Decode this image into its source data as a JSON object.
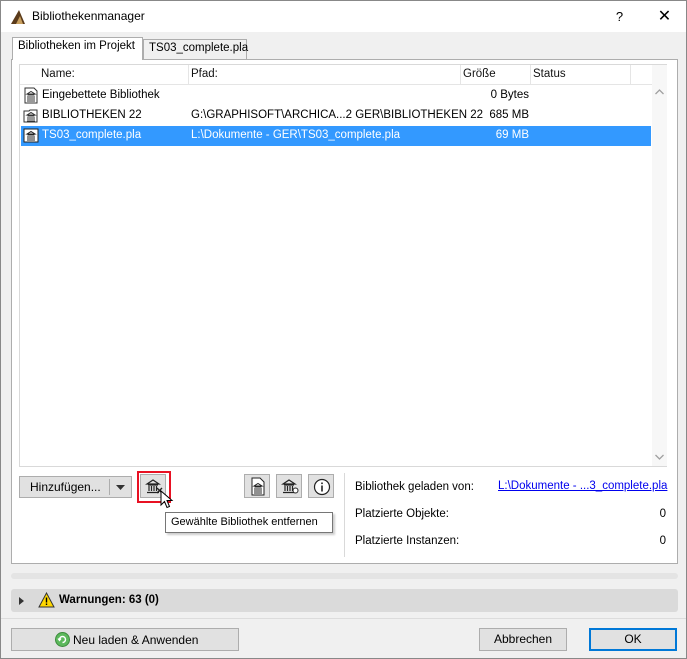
{
  "window": {
    "title": "Bibliothekenmanager",
    "help": "?",
    "close": "✕"
  },
  "tabs": [
    {
      "label": "Bibliotheken im Projekt"
    },
    {
      "label": "TS03_complete.pla"
    }
  ],
  "table": {
    "columns": [
      "Name:",
      "Pfad:",
      "Größe",
      "Status"
    ],
    "rows": [
      {
        "name": "Eingebettete Bibliothek",
        "path": "",
        "size": "0 Bytes",
        "status": ""
      },
      {
        "name": "BIBLIOTHEKEN 22",
        "path": "G:\\GRAPHISOFT\\ARCHICA...2 GER\\BIBLIOTHEKEN 22",
        "size": "685 MB",
        "status": ""
      },
      {
        "name": "TS03_complete.pla",
        "path": "L:\\Dokumente - GER\\TS03_complete.pla",
        "size": "69 MB",
        "status": ""
      }
    ]
  },
  "toolbar": {
    "add_label": "Hinzufügen...",
    "tooltip": "Gewählte Bibliothek entfernen"
  },
  "info": {
    "loaded_from_label": "Bibliothek geladen von:",
    "loaded_from_value": "L:\\Dokumente - ...3_complete.pla",
    "placed_objects_label": "Platzierte Objekte:",
    "placed_objects_value": "0",
    "placed_instances_label": "Platzierte Instanzen:",
    "placed_instances_value": "0"
  },
  "warnings": {
    "label": "Warnungen: 63 (0)"
  },
  "buttons": {
    "reload": "Neu laden & Anwenden",
    "cancel": "Abbrechen",
    "ok": "OK"
  },
  "colors": {
    "selection": "#3399ff",
    "highlight": "#e81123",
    "ok_border": "#0078d7"
  }
}
